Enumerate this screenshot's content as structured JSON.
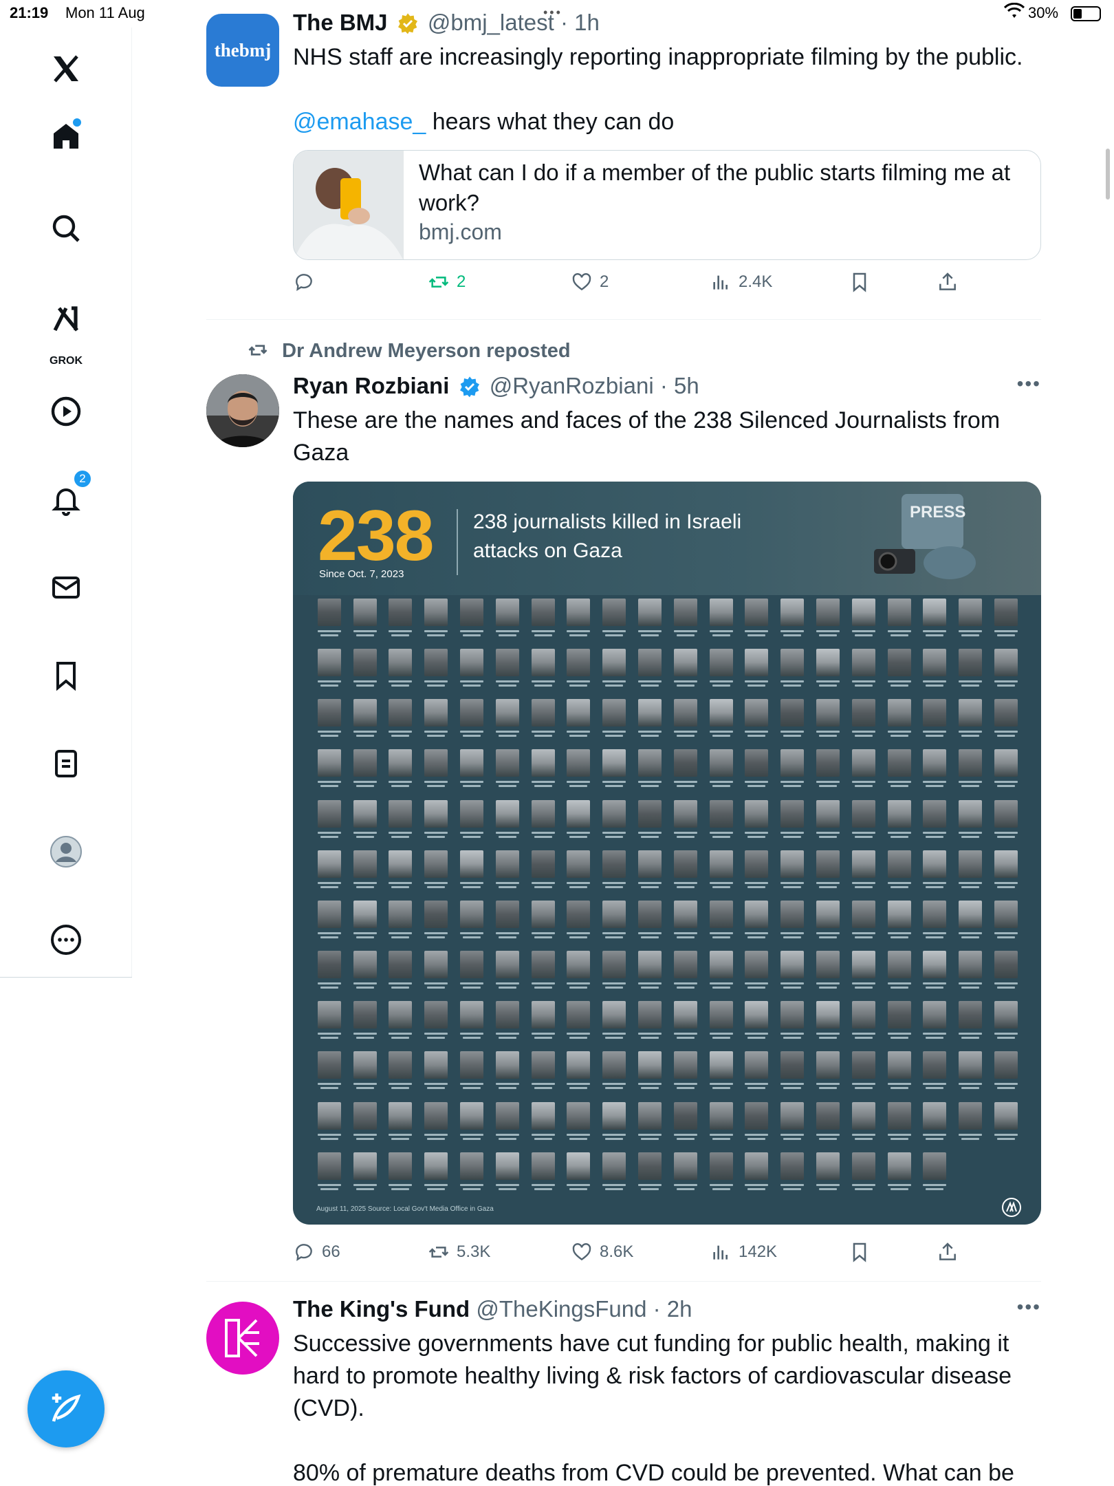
{
  "status_bar": {
    "time": "21:19",
    "date": "Mon 11 Aug",
    "battery": "30%"
  },
  "sidebar": {
    "grok_label": "GROK",
    "notifications_badge": "2",
    "items": [
      "x-logo",
      "home-icon",
      "search-icon",
      "grok-icon",
      "video-icon",
      "notifications-icon",
      "messages-icon",
      "bookmarks-icon",
      "lists-icon",
      "profile-icon",
      "more-icon"
    ]
  },
  "posts": [
    {
      "name": "The BMJ",
      "handle": "@bmj_latest",
      "time": "· 1h",
      "avatar_text": "thebmj",
      "text_line1": "NHS staff are increasingly reporting inappropriate filming by the public.",
      "mention": "@emahase_",
      "text_line2": " hears what they can do",
      "card_title": "What can I do if a member of the public starts filming me at work?",
      "card_domain": "bmj.com",
      "replies": "",
      "reposts": "2",
      "likes": "2",
      "views": "2.4K"
    },
    {
      "repost_by": "Dr Andrew Meyerson reposted",
      "name": "Ryan Rozbiani",
      "handle": "@RyanRozbiani",
      "time": "· 5h",
      "text": "These are the names and faces of the 238 Silenced Journalists from Gaza",
      "infographic": {
        "big_number": "238",
        "since": "Since Oct. 7, 2023",
        "headline": "238 journalists killed in Israeli attacks on Gaza",
        "press": "PRESS",
        "footer": "August 11, 2025   Source: Local Gov't Media Office in Gaza",
        "faces_count": 238
      },
      "replies": "66",
      "reposts": "5.3K",
      "likes": "8.6K",
      "views": "142K"
    },
    {
      "name": "The King's Fund",
      "handle": "@TheKingsFund",
      "time": "· 2h",
      "text": "Successive governments have cut funding for public health, making it hard to promote healthy living & risk factors of cardiovascular disease (CVD).",
      "text2": "80% of premature deaths from CVD could be prevented. What can be"
    }
  ],
  "colors": {
    "accent": "#1d9bf0",
    "retweet_active": "#00ba7c",
    "gold": "#f3b229",
    "kingsfund": "#e20ec2"
  }
}
